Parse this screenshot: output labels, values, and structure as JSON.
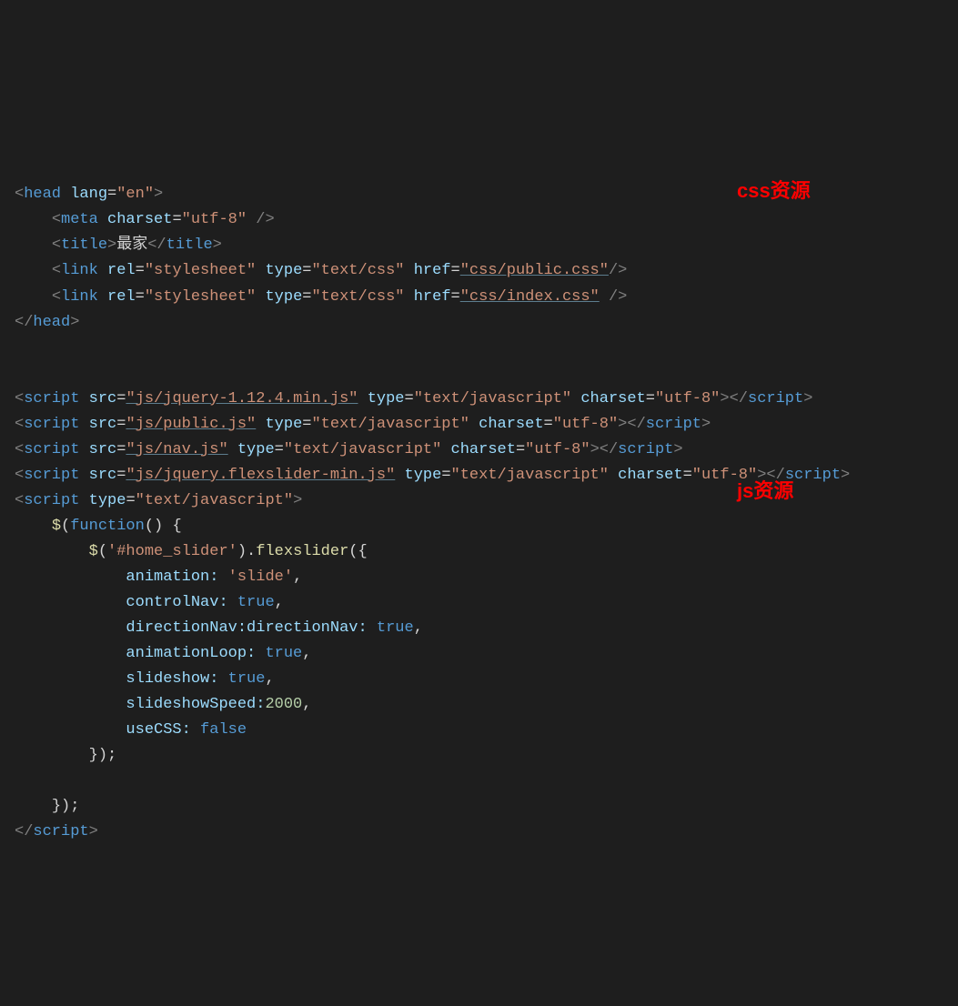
{
  "annotations": {
    "css_label": "css资源",
    "js_label": "js资源"
  },
  "head": {
    "open": "head",
    "lang_attr": "lang",
    "lang_val": "\"en\"",
    "meta": "meta",
    "charset_attr": "charset",
    "charset_val": "\"utf-8\"",
    "meta_close": " />",
    "title_tag": "title",
    "title_text": "最家",
    "link": "link",
    "rel_attr": "rel",
    "rel_val": "\"stylesheet\"",
    "type_attr": "type",
    "type_css": "\"text/css\"",
    "href_attr": "href",
    "href1": "\"css/public.css\"",
    "href2": "\"css/index.css\"",
    "close": "head"
  },
  "scripts": {
    "tag": "script",
    "src_attr": "src",
    "type_attr": "type",
    "type_js": "\"text/javascript\"",
    "charset_attr": "charset",
    "charset_val": "\"utf-8\"",
    "src1": "\"js/jquery-1.12.4.min.js\"",
    "src2": "\"js/public.js\"",
    "src3": "\"js/nav.js\"",
    "src4": "\"js/jquery.flexslider-min.js\""
  },
  "inline": {
    "jq": "$",
    "func_kw": "function",
    "selector": "'#home_slider'",
    "method": "flexslider",
    "opts": {
      "animation_k": "animation:",
      "animation_v": "'slide'",
      "controlNav_k": "controlNav:",
      "directionNav_k": "directionNav:",
      "animationLoop_k": "animationLoop:",
      "slideshow_k": "slideshow:",
      "slideshowSpeed_k": "slideshowSpeed:",
      "slideshowSpeed_v": "2000",
      "useCSS_k": "useCSS:",
      "true": "true",
      "false": "false"
    }
  }
}
